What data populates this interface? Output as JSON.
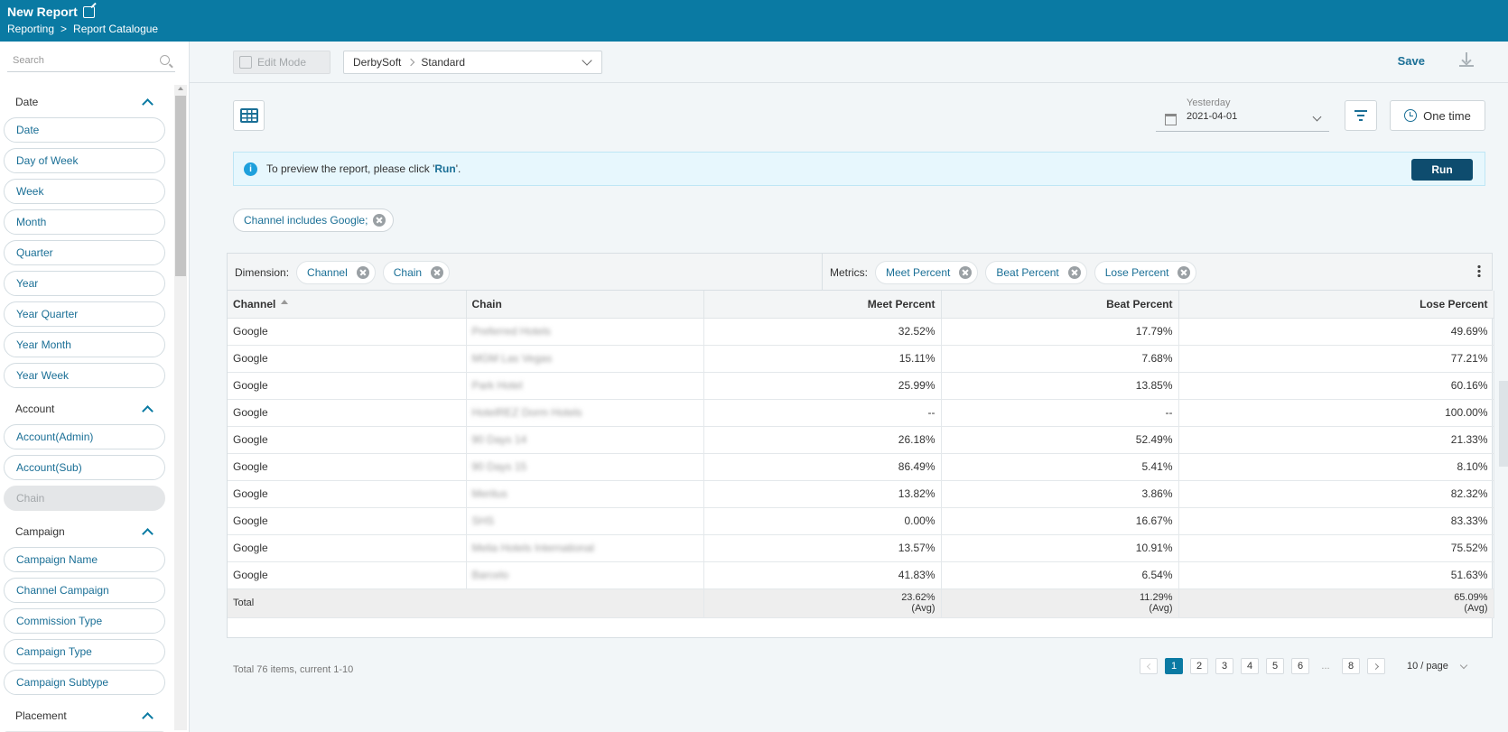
{
  "header": {
    "title": "New Report",
    "breadcrumb": [
      "Reporting",
      ">",
      "Report Catalogue"
    ]
  },
  "sidebar": {
    "search_placeholder": "Search",
    "groups": [
      {
        "label": "Date",
        "items": [
          "Date",
          "Day of Week",
          "Week",
          "Month",
          "Quarter",
          "Year",
          "Year Quarter",
          "Year Month",
          "Year Week"
        ]
      },
      {
        "label": "Account",
        "items": [
          "Account(Admin)",
          "Account(Sub)",
          "Chain"
        ]
      },
      {
        "label": "Campaign",
        "items": [
          "Campaign Name",
          "Channel Campaign",
          "Commission Type",
          "Campaign Type",
          "Campaign Subtype"
        ]
      },
      {
        "label": "Placement",
        "items": []
      }
    ]
  },
  "toolbar": {
    "edit_mode_label": "Edit Mode",
    "template_path": [
      "DerbySoft",
      "Standard"
    ],
    "save_label": "Save"
  },
  "controls": {
    "date_label": "Yesterday",
    "date_value": "2021-04-01",
    "schedule_label": "One time"
  },
  "info": {
    "text_before": "To preview the report, please click '",
    "run_word": "Run",
    "text_after": "'.",
    "run_button": "Run"
  },
  "filter_chip": "Channel includes Google;",
  "dimensions": {
    "label": "Dimension:",
    "items": [
      "Channel",
      "Chain"
    ]
  },
  "metrics": {
    "label": "Metrics:",
    "items": [
      "Meet Percent",
      "Beat Percent",
      "Lose Percent"
    ]
  },
  "table": {
    "columns": [
      "Channel",
      "Chain",
      "Meet Percent",
      "Beat Percent",
      "Lose Percent"
    ],
    "rows": [
      [
        "Google",
        "Preferred Hotels",
        "32.52%",
        "17.79%",
        "49.69%"
      ],
      [
        "Google",
        "MGM Las Vegas",
        "15.11%",
        "7.68%",
        "77.21%"
      ],
      [
        "Google",
        "Park Hotel",
        "25.99%",
        "13.85%",
        "60.16%"
      ],
      [
        "Google",
        "HotelREZ Dorm Hotels",
        "--",
        "--",
        "100.00%"
      ],
      [
        "Google",
        "90 Days 14",
        "26.18%",
        "52.49%",
        "21.33%"
      ],
      [
        "Google",
        "90 Days 15",
        "86.49%",
        "5.41%",
        "8.10%"
      ],
      [
        "Google",
        "Meritus",
        "13.82%",
        "3.86%",
        "82.32%"
      ],
      [
        "Google",
        "SHS",
        "0.00%",
        "16.67%",
        "83.33%"
      ],
      [
        "Google",
        "Melia Hotels International",
        "13.57%",
        "10.91%",
        "75.52%"
      ],
      [
        "Google",
        "Barcelo",
        "41.83%",
        "6.54%",
        "51.63%"
      ]
    ],
    "total": {
      "label": "Total",
      "meet": "23.62%",
      "beat": "11.29%",
      "lose": "65.09%",
      "avg": "(Avg)"
    }
  },
  "pagination": {
    "summary": "Total 76 items, current 1-10",
    "pages": [
      "1",
      "2",
      "3",
      "4",
      "5",
      "6",
      "...",
      "8"
    ],
    "current": "1",
    "page_size": "10 / page"
  }
}
